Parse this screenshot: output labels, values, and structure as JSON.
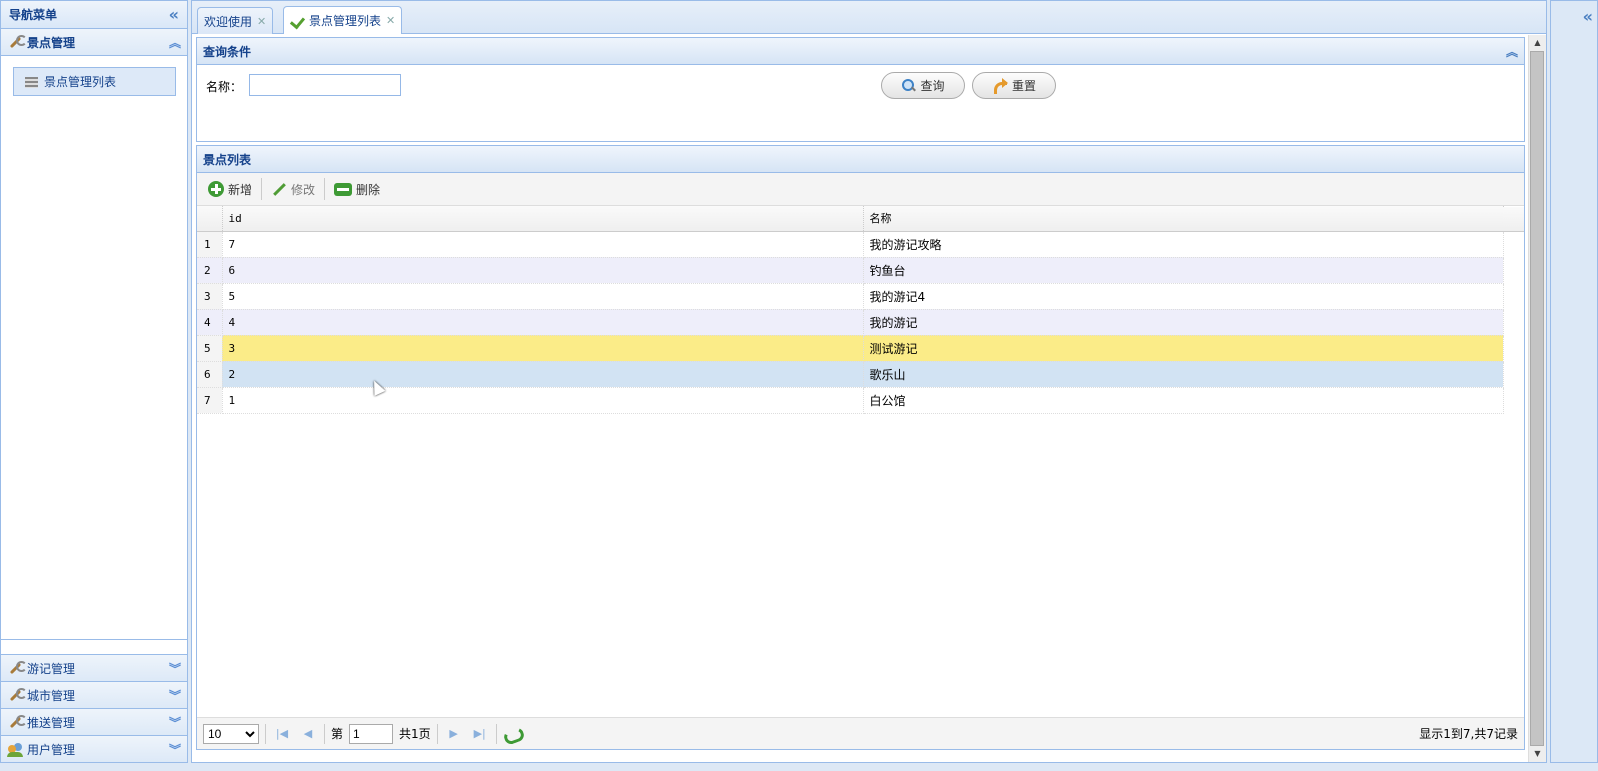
{
  "west": {
    "title": "导航菜单",
    "collapse_icon": "«",
    "accordions": [
      {
        "label": "景点管理",
        "expanded": true,
        "icon": "wrench-icon"
      },
      {
        "label": "游记管理",
        "expanded": false,
        "icon": "wrench-icon"
      },
      {
        "label": "城市管理",
        "expanded": false,
        "icon": "wrench-icon"
      },
      {
        "label": "推送管理",
        "expanded": false,
        "icon": "wrench-icon"
      },
      {
        "label": "用户管理",
        "expanded": false,
        "icon": "users-icon"
      }
    ],
    "nav_link": "景点管理列表"
  },
  "tabs": [
    {
      "label": "欢迎使用",
      "active": false
    },
    {
      "label": "景点管理列表",
      "active": true
    }
  ],
  "query": {
    "title": "查询条件",
    "name_label": "名称：",
    "name_value": "",
    "search_label": "查询",
    "reset_label": "重置"
  },
  "grid": {
    "title": "景点列表",
    "toolbar": {
      "add": "新增",
      "edit": "修改",
      "delete": "删除"
    },
    "columns": [
      "id",
      "名称"
    ],
    "rows": [
      {
        "num": "1",
        "id": "7",
        "name": "我的游记攻略"
      },
      {
        "num": "2",
        "id": "6",
        "name": "钓鱼台"
      },
      {
        "num": "3",
        "id": "5",
        "name": "我的游记4"
      },
      {
        "num": "4",
        "id": "4",
        "name": "我的游记"
      },
      {
        "num": "5",
        "id": "3",
        "name": "测试游记"
      },
      {
        "num": "6",
        "id": "2",
        "name": "歌乐山"
      },
      {
        "num": "7",
        "id": "1",
        "name": "白公馆"
      }
    ],
    "selected_row": 5,
    "hover_row": 6
  },
  "pager": {
    "page_size": "10",
    "page_prefix": "第",
    "page_value": "1",
    "total_pages": "共1页",
    "info": "显示1到7,共7记录"
  },
  "colors": {
    "header_blue": "#15428b",
    "border": "#99bbe8",
    "selected": "#fbec88",
    "hover": "#d2e3f3",
    "alt_row": "#eeeefa"
  }
}
